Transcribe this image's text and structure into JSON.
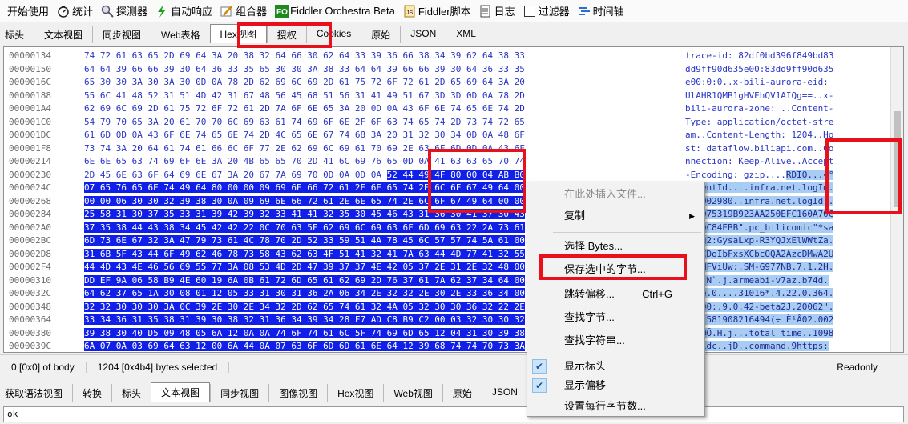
{
  "toolbar": [
    {
      "name": "tb-getting-started",
      "label": "开始使用",
      "icon": ""
    },
    {
      "name": "tb-statistics",
      "label": "统计",
      "icon": "stopwatch-icon"
    },
    {
      "name": "tb-inspectors",
      "label": "探测器",
      "icon": "magnifier-icon"
    },
    {
      "name": "tb-autoresponder",
      "label": "自动响应",
      "icon": "lightning-icon"
    },
    {
      "name": "tb-composer",
      "label": "组合器",
      "icon": "pencil-icon"
    },
    {
      "name": "tb-orchestra",
      "label": "Fiddler Orchestra Beta",
      "icon": "fo-icon"
    },
    {
      "name": "tb-script",
      "label": "Fiddler脚本",
      "icon": "script-icon"
    },
    {
      "name": "tb-log",
      "label": "日志",
      "icon": "log-icon"
    },
    {
      "name": "tb-filters",
      "label": "过滤器",
      "icon": "checkbox-icon"
    },
    {
      "name": "tb-timeline",
      "label": "时间轴",
      "icon": "timeline-icon"
    }
  ],
  "request_tabs": [
    "标头",
    "文本视图",
    "同步视图",
    "Web表格",
    "Hex视图",
    "授权",
    "Cookies",
    "原始",
    "JSON",
    "XML"
  ],
  "hex_rows": [
    {
      "offset": "00000134",
      "hex": "74 72 61 63 65 2D 69 64 3A 20 38 32 64 66 30 62 64 33 39 36 66 38 34 39 62 64 38 33",
      "ascii": "trace-id: 82df0bd396f849bd83"
    },
    {
      "offset": "00000150",
      "hex": "64 64 39 66 66 39 30 64 36 33 35 65 30 30 3A 38 33 64 64 39 66 66 39 30 64 36 33 35",
      "ascii": "dd9ff90d635e00:83dd9ff90d635"
    },
    {
      "offset": "0000016C",
      "hex": "65 30 30 3A 30 3A 30 0D 0A 78 2D 62 69 6C 69 2D 61 75 72 6F 72 61 2D 65 69 64 3A 20",
      "ascii": "e00:0:0..x-bili-aurora-eid: "
    },
    {
      "offset": "00000188",
      "hex": "55 6C 41 48 52 31 51 4D 42 31 67 48 56 45 68 51 56 31 41 49 51 67 3D 3D 0D 0A 78 2D",
      "ascii": "UlAHR1QMB1gHVEhQV1AIQg==..x-"
    },
    {
      "offset": "000001A4",
      "hex": "62 69 6C 69 2D 61 75 72 6F 72 61 2D 7A 6F 6E 65 3A 20 0D 0A 43 6F 6E 74 65 6E 74 2D",
      "ascii": "bili-aurora-zone: ..Content-"
    },
    {
      "offset": "000001C0",
      "hex": "54 79 70 65 3A 20 61 70 70 6C 69 63 61 74 69 6F 6E 2F 6F 63 74 65 74 2D 73 74 72 65",
      "ascii": "Type: application/octet-stre"
    },
    {
      "offset": "000001DC",
      "hex": "61 6D 0D 0A 43 6F 6E 74 65 6E 74 2D 4C 65 6E 67 74 68 3A 20 31 32 30 34 0D 0A 48 6F",
      "ascii": "am..Content-Length: 1204..Ho"
    },
    {
      "offset": "000001F8",
      "hex": "73 74 3A 20 64 61 74 61 66 6C 6F 77 2E 62 69 6C 69 61 70 69 2E 63 6F 6D 0D 0A 43 6F",
      "ascii": "st: dataflow.biliapi.com..Co"
    },
    {
      "offset": "00000214",
      "hex": "6E 6E 65 63 74 69 6F 6E 3A 20 4B 65 65 70 2D 41 6C 69 76 65 0D 0A 41 63 63 65 70 74",
      "ascii": "nnection: Keep-Alive..Accept"
    },
    {
      "offset": "00000230",
      "hex": "2D 45 6E 63 6F 64 69 6E 67 3A 20 67 7A 69 70 0D 0A 0D 0A 52 44 49 4F 80 00 04 AB B0",
      "ascii": "-Encoding: gzip....RDIO...«°"
    },
    {
      "offset": "0000024C",
      "hex": "07 65 76 65 6E 74 49 64 80 00 00 09 69 6E 66 72 61 2E 6E 65 74 2E 6C 6F 67 49 64 00",
      "ascii": ".eventId....infra.net.logId."
    },
    {
      "offset": "00000268",
      "hex": "00 00 06 30 30 32 39 38 30 0A 09 69 6E 66 72 61 2E 6E 65 74 2E 6C 6F 67 49 64 00 00",
      "ascii": "...002980..infra.net.logId.."
    },
    {
      "offset": "00000284",
      "hex": "25 58 31 30 37 35 33 31 39 42 39 32 33 41 41 32 35 30 45 46 43 31 36 30 41 37 30 43",
      "ascii": "%X1075319B923AA250EFC160A70C"
    },
    {
      "offset": "000002A0",
      "hex": "37 35 38 44 43 38 34 45 42 42 22 0C 70 63 5F 62 69 6C 69 63 6F 6D 69 63 22 2A 73 61",
      "ascii": "758DC84EBB\".pc_bilicomic\"*sa"
    },
    {
      "offset": "000002BC",
      "hex": "6D 73 6E 67 32 3A 47 79 73 61 4C 78 70 2D 52 33 59 51 4A 78 45 6C 57 57 74 5A 61 00",
      "ascii": "msng2:GysaLxp-R3YQJxElWWtZa."
    },
    {
      "offset": "000002D8",
      "hex": "31 6B 5F 43 44 6F 49 62 46 78 73 58 43 62 63 4F 51 41 32 41 7A 63 44 4D 77 41 32 55",
      "ascii": "1k_CDoIbFxsXCbcOQA2AzcDMwA2U"
    },
    {
      "offset": "000002F4",
      "hex": "44 4D 43 4E 46 56 69 55 77 3A 08 53 4D 2D 47 39 37 37 4E 42 05 37 2E 31 2E 32 48 00",
      "ascii": "DMCNFViUw:.SM-G977NB.7.1.2H."
    },
    {
      "offset": "00000310",
      "hex": "DD EF 9A 06 58 B9 4E 60 19 6A 0B 61 72 6D 65 61 62 69 2D 76 37 61 7A 62 37 34 64 00",
      "ascii": "ÝïX¹N`.j.armeabi-v7az.b74d."
    },
    {
      "offset": "0000032C",
      "hex": "64 62 37 65 1A 30 08 01 12 05 33 31 30 31 36 2A 06 34 2E 32 32 2E 30 2E 33 36 34 00",
      "ascii": "db7e.0....31016*.4.22.0.364."
    },
    {
      "offset": "00000348",
      "hex": "32 32 30 30 30 3A 0C 39 2E 30 2E 34 32 2D 62 65 74 61 32 4A 05 32 30 30 36 32 22 2E",
      "ascii": "22000:.9.0.42-beta2J.20062\"."
    },
    {
      "offset": "00000364",
      "hex": "33 34 36 31 35 38 31 39 30 38 32 31 36 34 39 34 28 F7 AD C8 B9 C2 00 03 32 30 30 32",
      "ascii": "3461581908216494(÷ È¹Â02.002"
    },
    {
      "offset": "00000380",
      "hex": "39 38 30 40 D5 09 48 05 6A 12 0A 0A 74 6F 74 61 6C 5F 74 69 6D 65 12 04 31 30 39 38",
      "ascii": "980@Õ.H.j...total_time..1098"
    },
    {
      "offset": "0000039C",
      "hex": "6A 07 0A 03 69 64 63 12 00 6A 44 0A 07 63 6F 6D 6D 61 6E 64 12 39 68 74 74 70 73 3A",
      "ascii": "j..idc..jD..command.9https:"
    },
    {
      "offset": "000003B8",
      "hex": "2F 2F 6D 61 6E 67 61 2E 62 69 6C 69 62 69 6C 69 2E 63 6F 6D 2F 74 77 69 72 70 2E 63",
      "ascii": "//manga.bilibili.com/twirp.c"
    }
  ],
  "status": {
    "position": "0 [0x0] of body",
    "selection": "1204 [0x4b4] bytes selected",
    "mode": "Readonly"
  },
  "response_tabs": [
    "获取语法视图",
    "转换",
    "标头",
    "文本视图",
    "同步视图",
    "图像视图",
    "Hex视图",
    "Web视图",
    "原始",
    "JSON",
    "XML"
  ],
  "response_text": "ok",
  "context_menu": {
    "insert_file": "在此处插入文件...",
    "copy": "复制",
    "select_bytes": "选择 Bytes...",
    "save_selected": "保存选中的字节...",
    "goto_offset": "跳转偏移...",
    "goto_shortcut": "Ctrl+G",
    "find_bytes": "查找字节...",
    "find_string": "查找字符串...",
    "show_header": "显示标头",
    "show_offset": "显示偏移",
    "bytes_per_line": "设置每行字节数..."
  }
}
